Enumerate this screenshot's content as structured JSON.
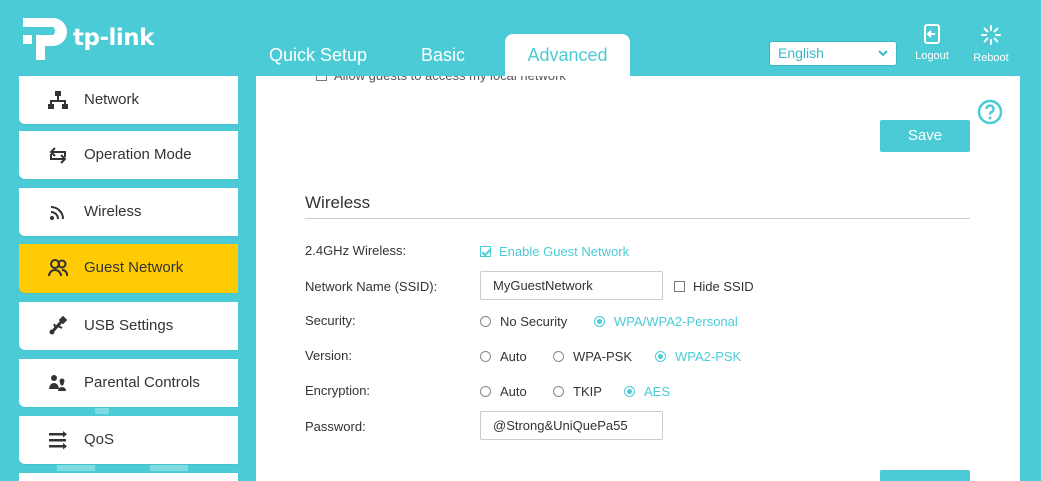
{
  "header": {
    "brand": "tp-link",
    "tabs": [
      {
        "label": "Quick Setup"
      },
      {
        "label": "Basic"
      },
      {
        "label": "Advanced",
        "active": true
      }
    ],
    "language": {
      "selected": "English"
    },
    "logout_label": "Logout",
    "reboot_label": "Reboot"
  },
  "sidebar": {
    "items": [
      {
        "label": "Network",
        "icon": "network-icon"
      },
      {
        "label": "Operation Mode",
        "icon": "operation-mode-icon"
      },
      {
        "label": "Wireless",
        "icon": "wireless-icon"
      },
      {
        "label": "Guest Network",
        "icon": "guest-network-icon",
        "active": true
      },
      {
        "label": "USB Settings",
        "icon": "usb-icon"
      },
      {
        "label": "Parental Controls",
        "icon": "parental-controls-icon"
      },
      {
        "label": "QoS",
        "icon": "qos-icon"
      }
    ]
  },
  "main": {
    "cut_row_label": "Allow guests to access my local network",
    "save_label": "Save",
    "wireless": {
      "title": "Wireless",
      "band_label": "2.4GHz Wireless:",
      "enable_label": "Enable Guest Network",
      "ssid_label": "Network Name (SSID):",
      "ssid_value": "MyGuestNetwork",
      "hide_ssid_label": "Hide SSID",
      "security_label": "Security:",
      "security_options": [
        "No Security",
        "WPA/WPA2-Personal"
      ],
      "version_label": "Version:",
      "version_options": [
        "Auto",
        "WPA-PSK",
        "WPA2-PSK"
      ],
      "encryption_label": "Encryption:",
      "encryption_options": [
        "Auto",
        "TKIP",
        "AES"
      ],
      "password_label": "Password:",
      "password_value": "@Strong&UniQuePa55"
    }
  },
  "colors": {
    "accent": "#4acbd6",
    "active_menu": "#ffcb05"
  }
}
